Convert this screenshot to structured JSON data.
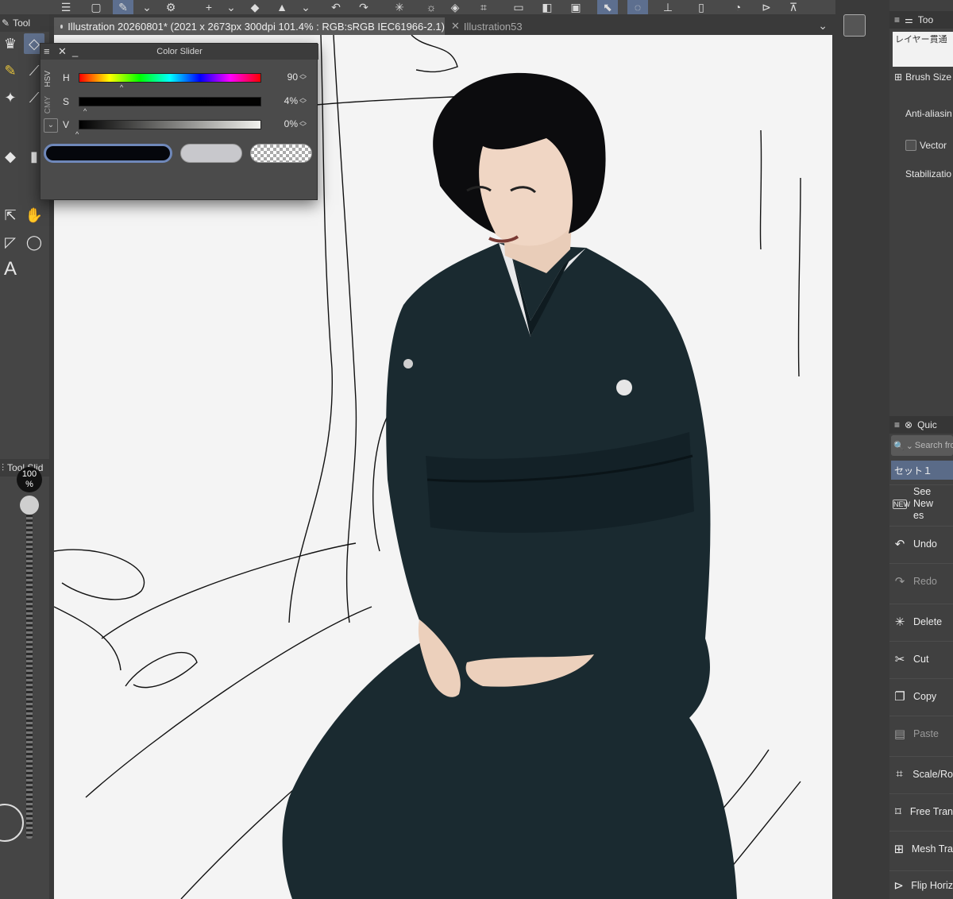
{
  "document_tabs": {
    "active": "Illustration 20260801* (2021 x 2673px 300dpi 101.4% : RGB:sRGB IEC61966-2.1)",
    "inactive": "Illustration53"
  },
  "tool_palette": {
    "header": "Tool",
    "icons": [
      "eyedropper-icon",
      "eraser-icon",
      "pen-icon",
      "brush-icon",
      "sparkle-icon",
      "airbrush-icon",
      "fill-icon",
      "gradient-icon",
      "move-icon",
      "hand-icon",
      "selection-icon",
      "lasso-icon"
    ],
    "text_tool": "A"
  },
  "sub_tool": {
    "header": "Tool Slid",
    "size_value": "100",
    "size_unit": "%"
  },
  "color_slider": {
    "title": "Color Slider",
    "modes": [
      "HSV",
      "CMY"
    ],
    "channels": [
      {
        "label": "H",
        "value": "90"
      },
      {
        "label": "S",
        "value": "4%"
      },
      {
        "label": "V",
        "value": "0%"
      }
    ],
    "colors": {
      "main": "#05070c",
      "sub": "#c8c8cc"
    }
  },
  "tool_property": {
    "header": "Too",
    "brush_preset": "レイヤー貫通",
    "brush_size_label": "Brush Size",
    "anti_aliasing_label": "Anti-aliasin",
    "vector_label": "Vector",
    "stabilization_label": "Stabilizatio"
  },
  "quick_access": {
    "header": "Quic",
    "search_placeholder": "Search fro",
    "set_name": "セット１",
    "commands": [
      {
        "label": "See New\nes",
        "icon": "new-icon",
        "enabled": true
      },
      {
        "label": "Undo",
        "icon": "undo-icon",
        "enabled": true
      },
      {
        "label": "Redo",
        "icon": "redo-icon",
        "enabled": false
      },
      {
        "label": "Delete",
        "icon": "delete-icon",
        "enabled": true
      },
      {
        "label": "Cut",
        "icon": "scissors-icon",
        "enabled": true
      },
      {
        "label": "Copy",
        "icon": "copy-icon",
        "enabled": true
      },
      {
        "label": "Paste",
        "icon": "paste-icon",
        "enabled": false
      },
      {
        "label": "Scale/Ro",
        "icon": "scale-icon",
        "enabled": true
      },
      {
        "label": "Free Tran",
        "icon": "free-transform-icon",
        "enabled": true
      },
      {
        "label": "Mesh Tra",
        "icon": "mesh-transform-icon",
        "enabled": true
      },
      {
        "label": "Flip Horiz",
        "icon": "flip-horizontal-icon",
        "enabled": true
      }
    ]
  }
}
